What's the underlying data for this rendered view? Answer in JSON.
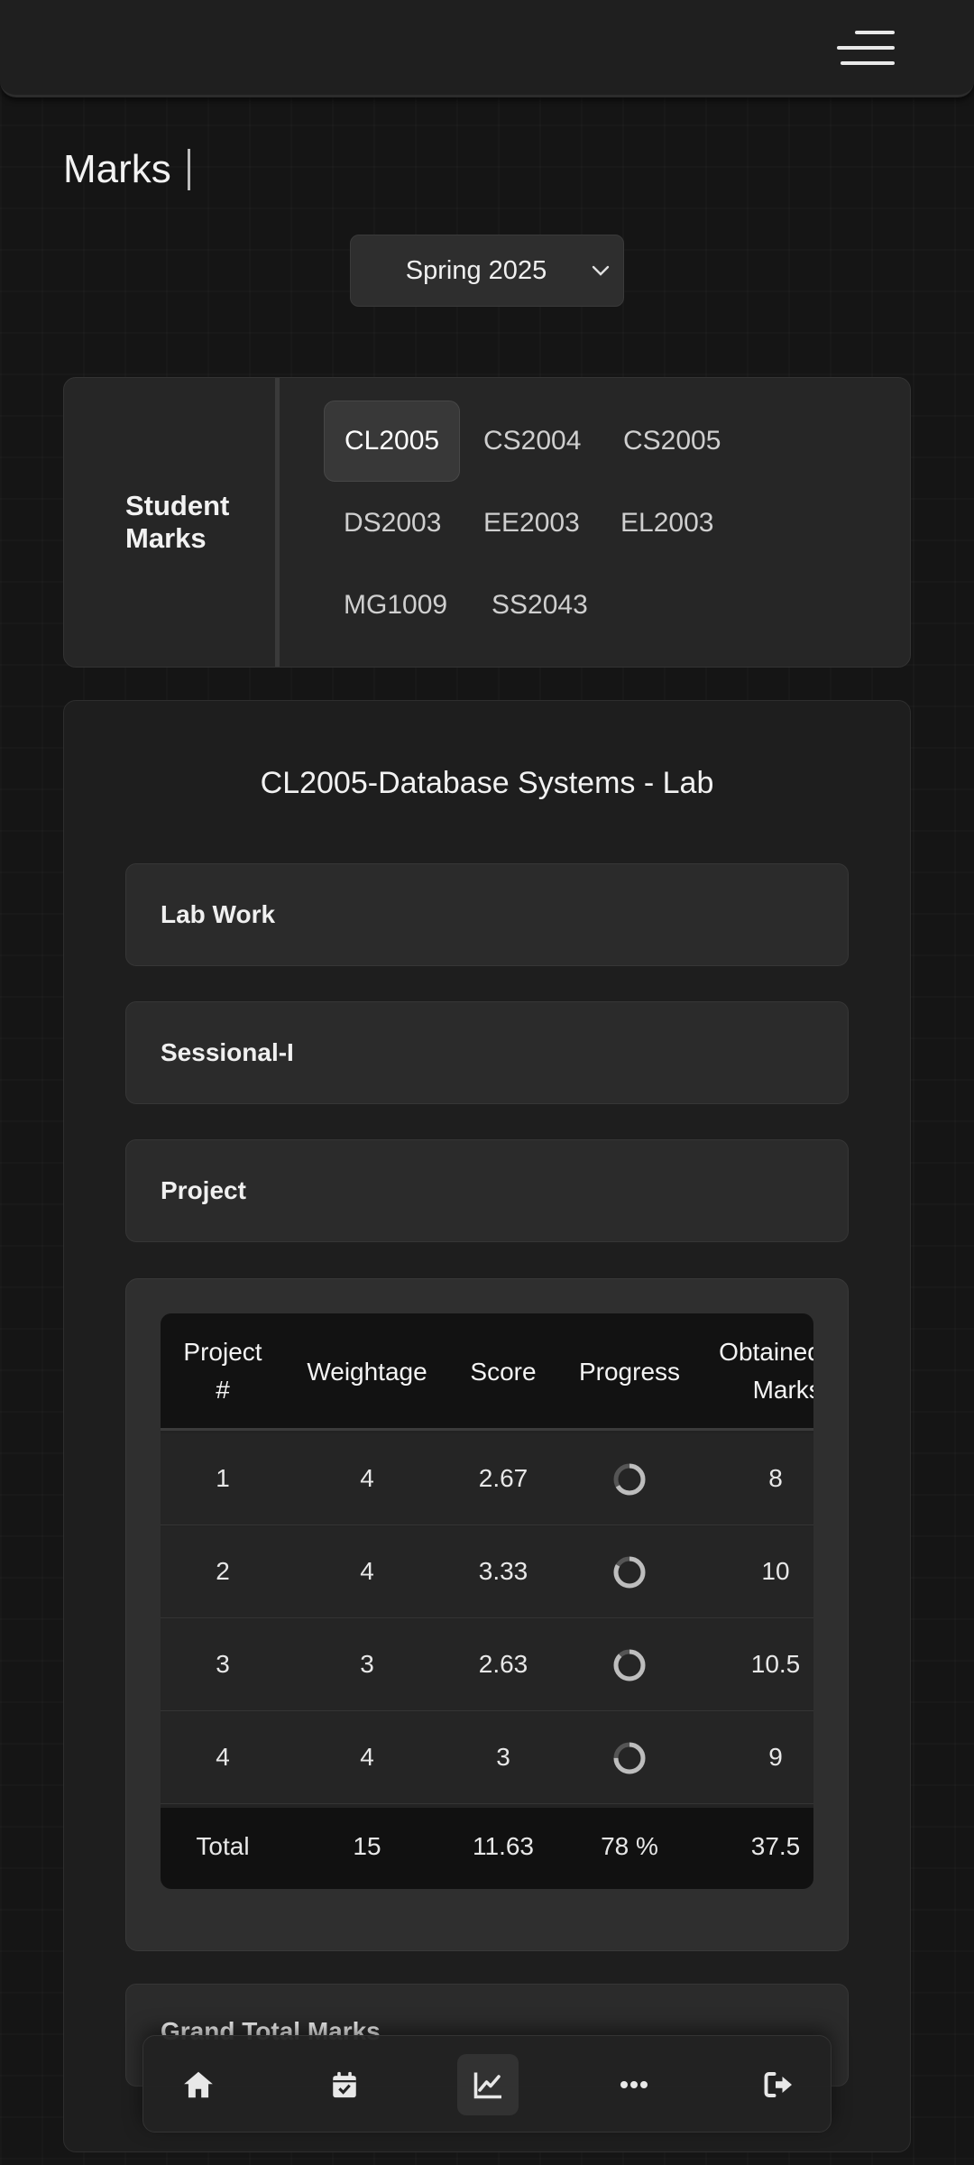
{
  "header": {
    "menu_icon": "hamburger-icon"
  },
  "page_title": "Marks",
  "semester": {
    "selected": "Spring 2025",
    "icon": "chevron-down-icon"
  },
  "student_marks": {
    "label_line1": "Student",
    "label_line2": "Marks",
    "courses": [
      "CL2005",
      "CS2004",
      "CS2005",
      "DS2003",
      "EE2003",
      "EL2003",
      "MG1009",
      "SS2043"
    ],
    "active_course": "CL2005"
  },
  "detail": {
    "course_title": "CL2005-Database Systems - Lab",
    "sections": [
      "Lab Work",
      "Sessional-I",
      "Project"
    ],
    "table": {
      "headers": {
        "project_line1": "Project",
        "project_line2": "#",
        "weightage": "Weightage",
        "score": "Score",
        "progress": "Progress",
        "obtained_line1": "Obtained",
        "obtained_line2": "Marks"
      },
      "rows": [
        {
          "num": "1",
          "weightage": "4",
          "score": "2.67",
          "progress": 0.6667,
          "obtained": "8"
        },
        {
          "num": "2",
          "weightage": "4",
          "score": "3.33",
          "progress": 0.8333,
          "obtained": "10"
        },
        {
          "num": "3",
          "weightage": "3",
          "score": "2.63",
          "progress": 0.8767,
          "obtained": "10.5"
        },
        {
          "num": "4",
          "weightage": "4",
          "score": "3",
          "progress": 0.75,
          "obtained": "9"
        }
      ],
      "total": {
        "label": "Total",
        "weightage": "15",
        "score": "11.63",
        "progress": "78 %",
        "obtained": "37.5"
      }
    },
    "grand_total_label": "Grand Total Marks"
  },
  "nav": {
    "items": [
      "home-icon",
      "calendar-check-icon",
      "chart-line-icon",
      "more-icon",
      "logout-icon"
    ],
    "active": "chart-line-icon"
  },
  "colors": {
    "background": "#151515",
    "card": "#262626",
    "text": "#e6e6e6",
    "spinner_track": "#555555",
    "spinner_fill": "#bdbdbd"
  }
}
